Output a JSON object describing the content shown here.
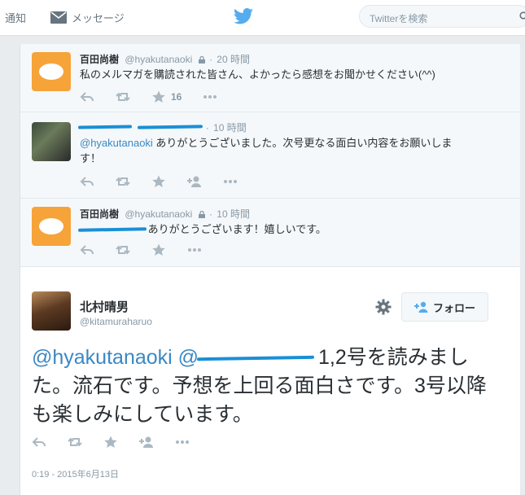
{
  "topbar": {
    "notify_label": "通知",
    "messages_label": "メッセージ",
    "search_placeholder": "Twitterを検索"
  },
  "tweets": [
    {
      "name": "百田尚樹",
      "handle": "@hyakutanaoki",
      "time": "20 時間",
      "text": "私のメルマガを購読された皆さん、よかったら感想をお聞かせください(^^)",
      "favorites": "16"
    },
    {
      "name": "",
      "handle": "",
      "time": "10 時間",
      "mention": "@hyakutanaoki",
      "text_line1": " ありがとうございました。次号更なる面白い内容をお願いしま",
      "text_line2": "す！"
    },
    {
      "name": "百田尚樹",
      "handle": "@hyakutanaoki",
      "time": "10 時間",
      "text": " ありがとうございます！嬉しいです。"
    }
  ],
  "main_tweet": {
    "name": "北村晴男",
    "handle": "@kitamuraharuo",
    "follow_label": "フォロー",
    "mention1": "@hyakutanaoki",
    "text_line1": " 1,2号を読み",
    "text_rest": "ました。流石です。予想を上回る面白さです。3号以降も楽しみにしています。",
    "date": "0:19 - 2015年6月13日"
  },
  "colors": {
    "accent": "#55acee",
    "mention": "#3b88c3",
    "redaction": "#1a8fd6"
  }
}
